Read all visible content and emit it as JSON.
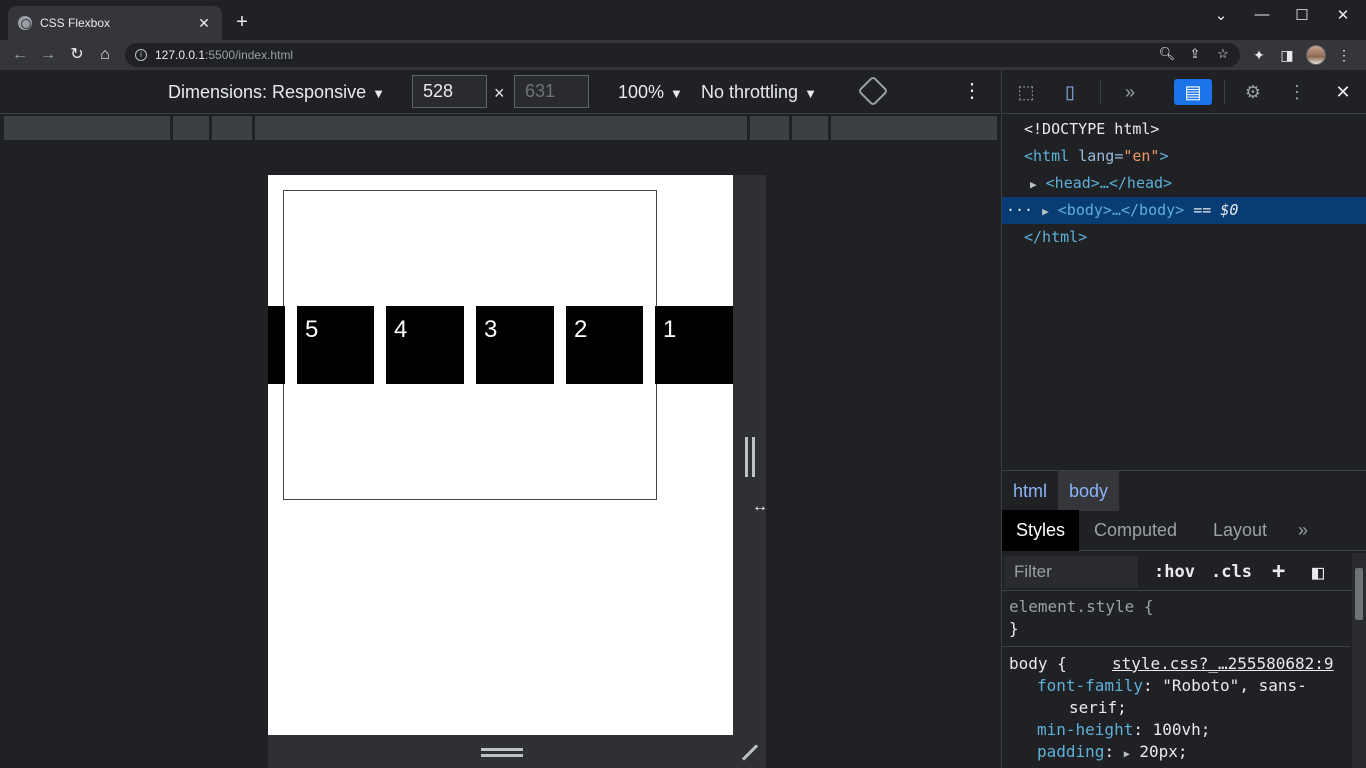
{
  "browser": {
    "tab_title": "CSS Flexbox",
    "tab_close": "✕",
    "new_tab": "+",
    "url_host": "127.0.0.1",
    "url_path": ":5500/index.html",
    "window_controls": {
      "dropdown": "⌄",
      "minimize": "—",
      "maximize": "☐",
      "close": "✕"
    },
    "nav": {
      "back": "←",
      "forward": "→",
      "reload": "↻",
      "home": "⌂"
    },
    "omnibox_icons": [
      "zoom-icon",
      "share-icon",
      "star-icon"
    ]
  },
  "device_toolbar": {
    "dimensions_label": "Dimensions: Responsive",
    "width_value": "528",
    "height_value": "631",
    "times": "×",
    "zoom": "100%",
    "throttling": "No throttling",
    "caret": "▼",
    "more": "⋮"
  },
  "page_preview": {
    "items": [
      "5",
      "4",
      "3",
      "2",
      "1"
    ]
  },
  "devtools": {
    "toolbar": {
      "more_tabs": "»",
      "settings": "⚙",
      "kebab": "⋮",
      "close": "✕"
    },
    "dom": {
      "doctype": "<!DOCTYPE html>",
      "html_open_tag": "<html",
      "html_attr_name": "lang",
      "html_attr_eq": "=",
      "html_attr_val": "\"en\"",
      "html_close_bracket": ">",
      "head": "<head>…</head>",
      "body": "<body>…</body>",
      "body_eq": "== $0",
      "html_close": "</html>",
      "dots": "···",
      "triangle": "▶"
    },
    "breadcrumbs": [
      "html",
      "body"
    ],
    "style_tabs": [
      "Styles",
      "Computed",
      "Layout",
      "»"
    ],
    "filter_placeholder": "Filter",
    "filter_tools": {
      "hov": ":hov",
      "cls": ".cls",
      "add": "+",
      "toggle": "◧"
    },
    "rules": {
      "element_style_open": "element.style {",
      "element_style_close": "}",
      "body_selector": "body {",
      "body_source": "style.css?_…255580682:9",
      "decl1_prop": "font-family",
      "decl1_val": "\"Roboto\", sans-",
      "decl1_val_cont": "serif;",
      "decl2_prop": "min-height",
      "decl2_val": "100vh;",
      "decl3_prop": "padding",
      "decl3_val": "20px;",
      "colon": ":",
      "expand": "▶"
    }
  }
}
